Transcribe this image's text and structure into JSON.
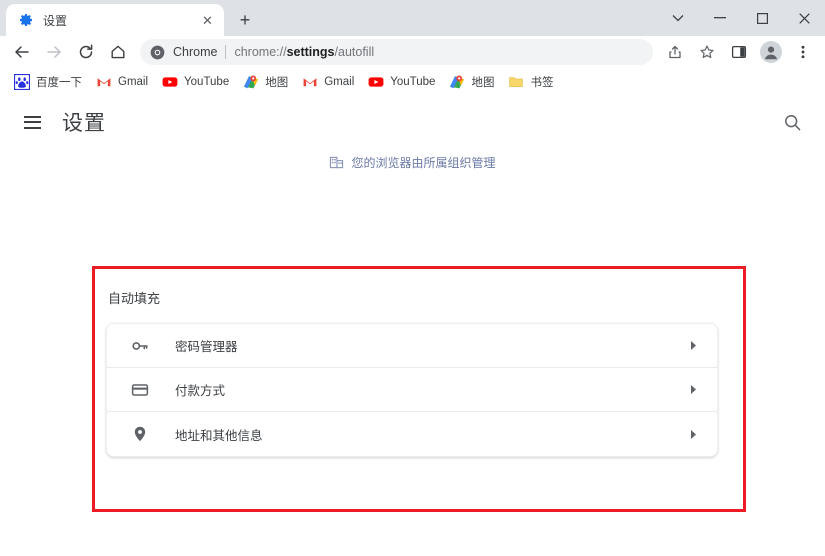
{
  "window": {
    "controls": [
      {
        "name": "tab-search",
        "glyph": "⌄"
      },
      {
        "name": "minimize",
        "glyph": "–"
      },
      {
        "name": "maximize",
        "glyph": "□"
      },
      {
        "name": "close",
        "glyph": "✕"
      }
    ]
  },
  "tabs": [
    {
      "title": "设置",
      "favicon": "gear-icon",
      "close_label": "✕"
    }
  ],
  "newtab_label": "+",
  "toolbar": {
    "back_label": "←",
    "forward_label": "→",
    "reload_label": "⟳",
    "home_label": "⌂",
    "omnibox": {
      "site_chip": "Chrome",
      "url_prefix": "chrome://",
      "url_bold": "settings",
      "url_suffix": "/autofill",
      "full_url": "chrome://settings/autofill"
    },
    "share_label": "",
    "star_label": "",
    "sidepanel_label": "",
    "profile_label": "",
    "menu_label": "⋮"
  },
  "bookmarks": [
    {
      "label": "百度一下",
      "icon": "baidu-icon"
    },
    {
      "label": "Gmail",
      "icon": "gmail-icon"
    },
    {
      "label": "YouTube",
      "icon": "youtube-icon"
    },
    {
      "label": "地图",
      "icon": "maps-icon"
    },
    {
      "label": "Gmail",
      "icon": "gmail-icon"
    },
    {
      "label": "YouTube",
      "icon": "youtube-icon"
    },
    {
      "label": "地图",
      "icon": "maps-icon"
    },
    {
      "label": "书签",
      "icon": "folder-icon"
    }
  ],
  "settings": {
    "title": "设置",
    "menu_label": "",
    "search_label": "",
    "managed_banner": "您的浏览器由所属组织管理",
    "section": {
      "title": "自动填充",
      "rows": [
        {
          "label": "密码管理器",
          "icon": "key-icon"
        },
        {
          "label": "付款方式",
          "icon": "credit-card-icon"
        },
        {
          "label": "地址和其他信息",
          "icon": "location-pin-icon"
        }
      ]
    }
  },
  "colors": {
    "accent_red": "#ed1c24",
    "chrome_tabstrip": "#dee1e6",
    "text_primary": "#3c4043",
    "text_secondary": "#70757a",
    "banner_blue": "#6b7aa6"
  }
}
